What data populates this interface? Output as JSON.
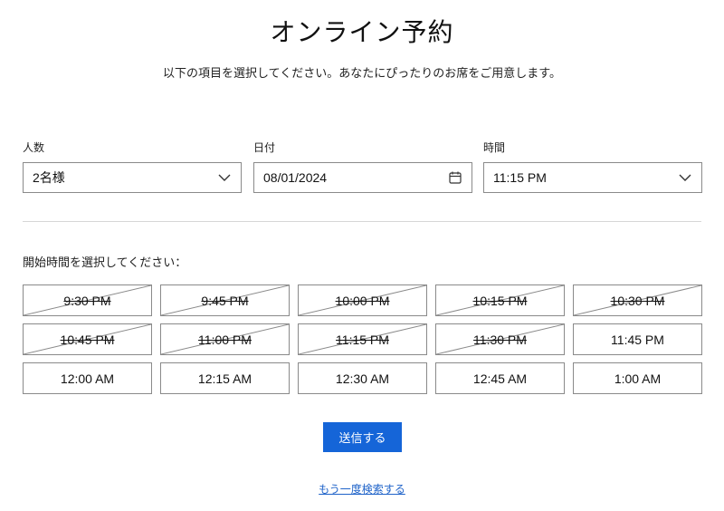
{
  "page": {
    "title": "オンライン予約",
    "subtitle": "以下の項目を選択してください。あなたにぴったりのお席をご用意します。"
  },
  "fields": {
    "party_size": {
      "label": "人数",
      "value": "2名様",
      "icon": "chevron-down-icon"
    },
    "date": {
      "label": "日付",
      "value": "08/01/2024",
      "icon": "calendar-icon"
    },
    "time": {
      "label": "時間",
      "value": "11:15 PM",
      "icon": "chevron-down-icon"
    }
  },
  "slots_label": "開始時間を選択してください：",
  "slots": [
    {
      "time": "9:30 PM",
      "available": false
    },
    {
      "time": "9:45 PM",
      "available": false
    },
    {
      "time": "10:00 PM",
      "available": false
    },
    {
      "time": "10:15 PM",
      "available": false
    },
    {
      "time": "10:30 PM",
      "available": false
    },
    {
      "time": "10:45 PM",
      "available": false
    },
    {
      "time": "11:00 PM",
      "available": false
    },
    {
      "time": "11:15 PM",
      "available": false
    },
    {
      "time": "11:30 PM",
      "available": false
    },
    {
      "time": "11:45 PM",
      "available": true
    },
    {
      "time": "12:00 AM",
      "available": true
    },
    {
      "time": "12:15 AM",
      "available": true
    },
    {
      "time": "12:30 AM",
      "available": true
    },
    {
      "time": "12:45 AM",
      "available": true
    },
    {
      "time": "1:00 AM",
      "available": true
    }
  ],
  "submit_label": "送信する",
  "search_again_label": "もう一度検索する",
  "colors": {
    "accent": "#1565d8",
    "link": "#1f63c9",
    "border": "#8a8a8a",
    "divider": "#d6d6d6"
  }
}
